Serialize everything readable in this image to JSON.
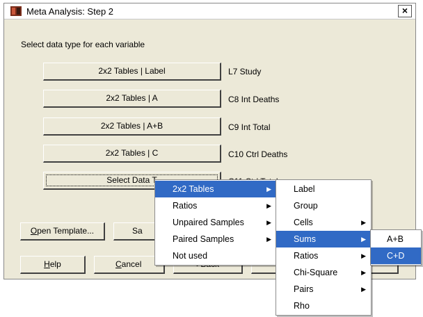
{
  "window": {
    "title": "Meta Analysis: Step 2",
    "close_label": "×"
  },
  "instruction": "Select data type for each variable",
  "variables": [
    {
      "button": "2x2 Tables | Label",
      "label": "L7 Study"
    },
    {
      "button": "2x2 Tables | A",
      "label": "C8 Int Deaths"
    },
    {
      "button": "2x2 Tables | A+B",
      "label": "C9 Int Total"
    },
    {
      "button": "2x2 Tables | C",
      "label": "C10 Ctrl Deaths"
    },
    {
      "button": "Select Data T",
      "label": "C11 Ctrl Total"
    }
  ],
  "buttons": {
    "open_template_u": "O",
    "open_template_rest": "pen Template...",
    "save_template_partial": "Sa",
    "help_u": "H",
    "help_rest": "elp",
    "cancel_u": "C",
    "cancel_rest": "ancel",
    "back_partial": "< Back"
  },
  "menu1": {
    "items": [
      "2x2 Tables",
      "Ratios",
      "Unpaired Samples",
      "Paired Samples",
      "Not used"
    ],
    "selected": "2x2 Tables"
  },
  "menu2": {
    "items": [
      "Label",
      "Group",
      "Cells",
      "Sums",
      "Ratios",
      "Chi-Square",
      "Pairs",
      "Rho"
    ],
    "selected": "Sums"
  },
  "menu3": {
    "items": [
      "A+B",
      "C+D"
    ],
    "selected": "C+D"
  },
  "submenu_arrow": "▶",
  "colors": {
    "highlight": "#316ac5",
    "dialog_bg": "#ece9d8"
  }
}
